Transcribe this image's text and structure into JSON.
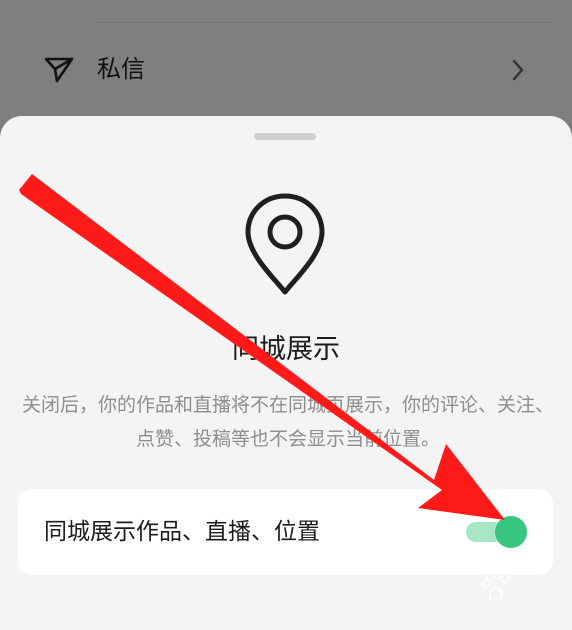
{
  "background_list": {
    "row": {
      "icon": "send-icon",
      "label": "私信",
      "chevron": "chevron-right-icon"
    }
  },
  "sheet": {
    "icon": "location-pin-icon",
    "title": "同城展示",
    "description": "关闭后，你的作品和直播将不在同城页展示，你的评论、关注、点赞、投稿等也不会显示当前位置。",
    "setting": {
      "label": "同城展示作品、直播、位置",
      "toggle_on": true
    }
  },
  "annotation": {
    "type": "red-arrow",
    "color": "#ff1a1a",
    "points_to": "same-city-toggle"
  },
  "watermark": {
    "text": "Bai 经验",
    "subtext": "jingyan.baidu.com"
  },
  "colors": {
    "toggle_track": "#a9e6c6",
    "toggle_knob": "#38c57f",
    "sheet_bg": "#f4f4f4",
    "card_bg": "#ffffff",
    "overlay": "rgba(0,0,0,0.50)"
  }
}
